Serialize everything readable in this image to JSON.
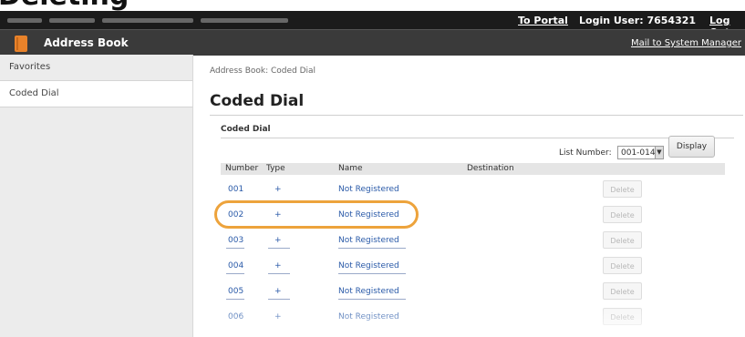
{
  "header": {
    "to_portal": "To Portal",
    "login_user": "Login User:  7654321",
    "logout": "Log Out"
  },
  "app": {
    "title": "Address Book",
    "mail_to_manager": "Mail to System Manager"
  },
  "sidebar": {
    "items": [
      {
        "label": "Favorites"
      },
      {
        "label": "Coded Dial"
      }
    ]
  },
  "main": {
    "breadcrumb": "Address Book: Coded Dial",
    "title": "Coded Dial",
    "section": "Coded Dial",
    "list_number_label": "List Number:",
    "list_number_value": "001-014",
    "display_button": "Display",
    "columns": [
      "Number",
      "Type",
      "Name",
      "Destination"
    ],
    "rows": [
      {
        "number": "001",
        "type": "+",
        "name": "Not Registered",
        "action": "Delete"
      },
      {
        "number": "002",
        "type": "+",
        "name": "Not Registered",
        "action": "Delete"
      },
      {
        "number": "003",
        "type": "+",
        "name": "Not Registered",
        "action": "Delete"
      },
      {
        "number": "004",
        "type": "+",
        "name": "Not Registered",
        "action": "Delete"
      },
      {
        "number": "005",
        "type": "+",
        "name": "Not Registered",
        "action": "Delete"
      },
      {
        "number": "006",
        "type": "+",
        "name": "Not Registered",
        "action": "Delete"
      }
    ]
  },
  "colors": {
    "topbar": "#1b1b1b",
    "appbar": "#3a3a3a",
    "accent": "#e8822a",
    "highlight": "#eda33c",
    "link": "#2a5aa8"
  }
}
